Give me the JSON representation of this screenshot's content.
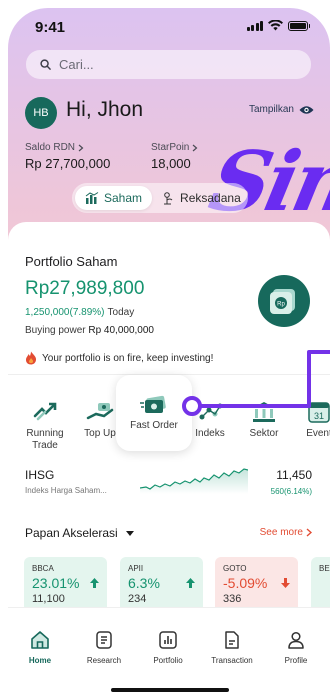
{
  "status": {
    "time": "9:41"
  },
  "search": {
    "placeholder": "Cari..."
  },
  "user": {
    "initials": "HB",
    "greeting": "Hi, Jhon"
  },
  "toggle": {
    "label": "Tampilkan"
  },
  "stats": [
    {
      "label": "Saldo RDN",
      "value": "Rp 27,700,000"
    },
    {
      "label": "StarPoin",
      "value": "18,000"
    }
  ],
  "tabs": [
    {
      "label": "Saham",
      "active": true
    },
    {
      "label": "Reksadana",
      "active": false
    }
  ],
  "portfolio": {
    "title": "Portfolio Saham",
    "value": "Rp27,989,800",
    "change": "1,250,000(7.89%)",
    "change_suffix": "Today",
    "buying_power_label": "Buying power",
    "buying_power_value": "Rp 40,000,000",
    "badge": "Rp",
    "fire_message": "Your portfolio is on fire, keep investing!"
  },
  "quick_menu": [
    {
      "label": "Running Trade",
      "icon": "running-trade-icon"
    },
    {
      "label": "Top Up",
      "icon": "top-up-icon"
    },
    {
      "label": "Fast Order",
      "icon": "fast-order-icon"
    },
    {
      "label": "Indeks",
      "icon": "indeks-icon"
    },
    {
      "label": "Sektor",
      "icon": "sektor-icon"
    },
    {
      "label": "Event",
      "icon": "event-icon"
    }
  ],
  "event_date": "31",
  "ihsg": {
    "name": "IHSG",
    "subtitle": "Indeks Harga Saham...",
    "value": "11,450",
    "change": "560(6.14%)"
  },
  "papan": {
    "title": "Papan Akselerasi",
    "see_more": "See more",
    "stocks": [
      {
        "code": "BBCA",
        "pct": "23.01%",
        "price": "11,100",
        "dir": "up"
      },
      {
        "code": "APII",
        "pct": "6.3%",
        "price": "234",
        "dir": "up"
      },
      {
        "code": "GOTO",
        "pct": "-5.09%",
        "price": "336",
        "dir": "down"
      },
      {
        "code": "BE",
        "pct": "",
        "price": "",
        "dir": "up"
      }
    ]
  },
  "nav": [
    {
      "label": "Home",
      "icon": "home-icon",
      "active": true
    },
    {
      "label": "Research",
      "icon": "research-icon",
      "active": false
    },
    {
      "label": "Portfolio",
      "icon": "portfolio-icon",
      "active": false
    },
    {
      "label": "Transaction",
      "icon": "transaction-icon",
      "active": false
    },
    {
      "label": "Profile",
      "icon": "profile-icon",
      "active": false
    }
  ],
  "colors": {
    "primary": "#17695c",
    "positive": "#16936f",
    "negative": "#e24c33",
    "accent": "#6a2cf1"
  }
}
